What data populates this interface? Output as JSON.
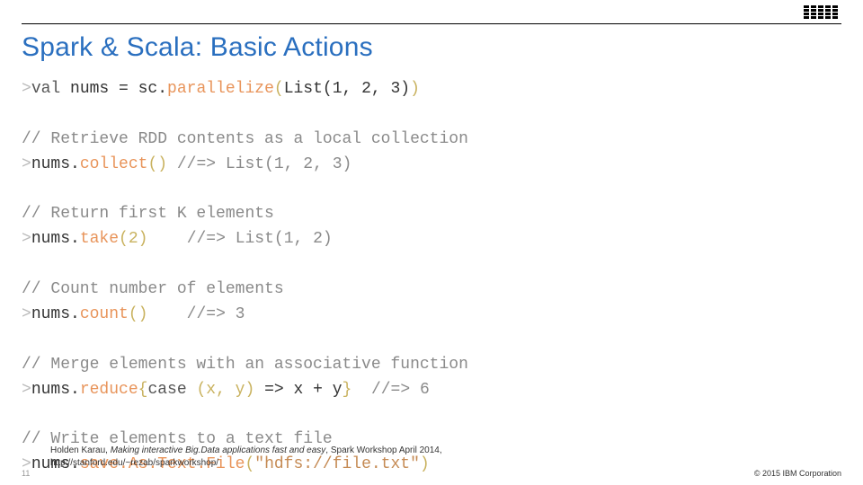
{
  "logo": {
    "name": "IBM"
  },
  "title": "Spark & Scala: Basic Actions",
  "code": {
    "line1": {
      "prompt": ">",
      "kw": "val",
      "rest1": " nums = sc.",
      "method": "parallelize",
      "lparen": "(",
      "args": "List(1, 2, 3)",
      "rparen": ")"
    },
    "blank1": " ",
    "comment1": "// Retrieve RDD contents as a local collection",
    "line2": {
      "prompt": ">",
      "rest1": "nums.",
      "method": "collect",
      "parens": "()",
      "tail": " //=> List(1, 2, 3)"
    },
    "blank2": " ",
    "comment2": "// Return first K elements",
    "line3": {
      "prompt": ">",
      "rest1": "nums.",
      "method": "take",
      "lparen": "(",
      "args": "2",
      "rparen": ")",
      "tail": "    //=> List(1, 2)"
    },
    "blank3": " ",
    "comment3": "// Count number of elements",
    "line4": {
      "prompt": ">",
      "rest1": "nums.",
      "method": "count",
      "parens": "()",
      "tail": "    //=> 3"
    },
    "blank4": " ",
    "comment4": "// Merge elements with an associative function",
    "line5": {
      "prompt": ">",
      "rest1": "nums.",
      "method": "reduce",
      "lbrace": "{",
      "kw": "case ",
      "lparen": "(",
      "args": "x, y",
      "rparen": ")",
      "mid": " => x + y",
      "rbrace": "}",
      "tail": "  //=> 6"
    },
    "blank5": " ",
    "comment5": "// Write elements to a text file",
    "line6": {
      "prompt": ">",
      "rest1": "nums.",
      "method": "save.As.Text.File",
      "lparen": "(",
      "str": "\"hdfs://file.txt\"",
      "rparen": ")"
    }
  },
  "footer": {
    "caption_prefix": "Holden Karau, ",
    "caption_italic": "Making interactive Big.Data applications fast and easy",
    "caption_suffix": ", Spark Workshop April 2014,",
    "caption_line2": "http://stanford.edu/~rezab/sparkworkshop/",
    "slidenum": "11",
    "copyright": "© 2015 IBM Corporation"
  }
}
